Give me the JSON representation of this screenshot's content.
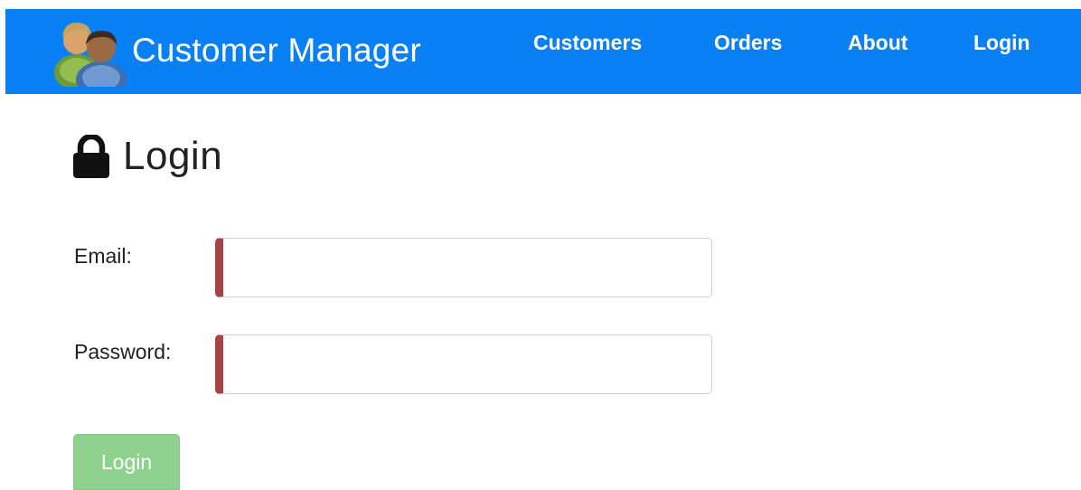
{
  "colors": {
    "navbar_background": "#0a80f5",
    "invalid_border": "#a94442",
    "login_button_disabled": "#8fd18f"
  },
  "navbar": {
    "brand": {
      "logo_icon": "people-icon",
      "title": "Customer Manager"
    },
    "links": [
      {
        "label": "Customers"
      },
      {
        "label": "Orders"
      },
      {
        "label": "About"
      },
      {
        "label": "Login"
      }
    ]
  },
  "main": {
    "title_icon": "lock-icon",
    "title": "Login",
    "form": {
      "email": {
        "label": "Email:",
        "value": "",
        "state": "invalid"
      },
      "password": {
        "label": "Password:",
        "value": "",
        "state": "invalid"
      },
      "submit": {
        "label": "Login",
        "state": "disabled"
      }
    }
  }
}
